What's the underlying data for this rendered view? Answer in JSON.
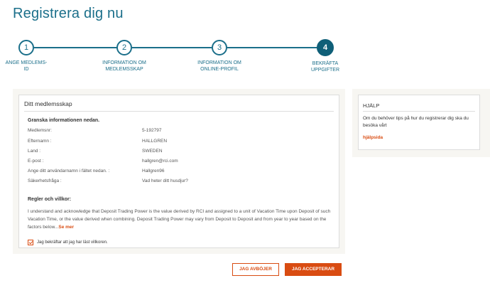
{
  "page": {
    "title": "Registrera dig nu"
  },
  "stepper": {
    "steps": [
      {
        "number": "1",
        "label_line1": "ANGE MEDLEMS-",
        "label_line2": "ID"
      },
      {
        "number": "2",
        "label_line1": "INFORMATION OM",
        "label_line2": "MEDLEMSSKAP"
      },
      {
        "number": "3",
        "label_line1": "INFORMATION OM",
        "label_line2": "ONLINE-PROFIL"
      },
      {
        "number": "4",
        "label_line1": "BEKRÄFTA",
        "label_line2": "UPPGIFTER"
      }
    ],
    "active_step": 4,
    "line_color": "#1b6f8a"
  },
  "membership": {
    "title": "Ditt medlemsskap",
    "review_heading": "Granska informationen nedan.",
    "rows": [
      {
        "label": "Medlemsnr:",
        "value": "5-192797"
      },
      {
        "label": "Efternamn :",
        "value": "HALLGREN"
      },
      {
        "label": "Land :",
        "value": "SWEDEN"
      },
      {
        "label": "E-post :",
        "value": "hallgren@rci.com"
      },
      {
        "label": "Ange ditt användarnamn i fältet nedan. :",
        "value": "Hallgren96"
      },
      {
        "label": "Säkerhetsfråga :",
        "value": "Vad heter ditt husdjur?"
      }
    ],
    "terms_heading": "Regler och villkor:",
    "terms_text": "I understand and acknowledge that Deposit Trading Power is the value derived by RCI and assigned to a unit of Vacation Time upon Deposit of such Vacation Time, or the value derived when combining. Deposit Trading Power may vary from Deposit to Deposit and from year to year based on the factors below...",
    "terms_more": "Se mer",
    "confirm_label": "Jag bekräftar att jag har läst villkoren.",
    "confirm_checked": true
  },
  "help": {
    "title": "HJÄLP",
    "text": "Om du behöver tips på hur du registrerar dig ska du besöka vårt",
    "link": "hjälpsida"
  },
  "actions": {
    "decline_label": "JAG AVBÖJER",
    "accept_label": "JAG ACCEPTERAR"
  },
  "colors": {
    "primary": "#1b6f8a",
    "accent": "#d94c12",
    "panel_bg": "#f7f6f2"
  }
}
